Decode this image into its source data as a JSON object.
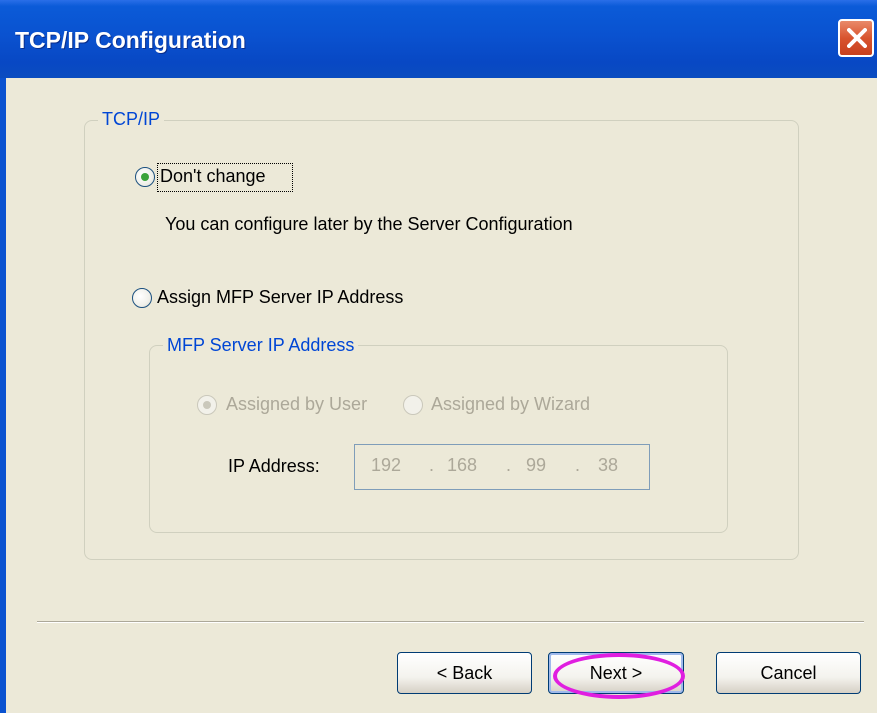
{
  "window": {
    "title": "TCP/IP Configuration"
  },
  "tcpip_group": {
    "legend": "TCP/IP",
    "option_dont_change": {
      "label": "Don't change",
      "selected": true
    },
    "hint": "You can configure later by the Server Configuration",
    "option_assign": {
      "label": "Assign MFP Server IP Address",
      "selected": false
    }
  },
  "mfp_group": {
    "legend": "MFP Server IP Address",
    "option_user": {
      "label": "Assigned by User",
      "selected": true
    },
    "option_wizard": {
      "label": "Assigned by Wizard",
      "selected": false
    },
    "ip_label": "IP Address:",
    "ip": {
      "o1": "192",
      "o2": "168",
      "o3": "99",
      "o4": "38",
      "sep": "."
    }
  },
  "buttons": {
    "back": "< Back",
    "next": "Next >",
    "cancel": "Cancel"
  },
  "colors": {
    "titlebar": "#0a52d0",
    "dialog_bg": "#ece9d8",
    "legend": "#0046d5",
    "highlight": "#e01ee0"
  }
}
